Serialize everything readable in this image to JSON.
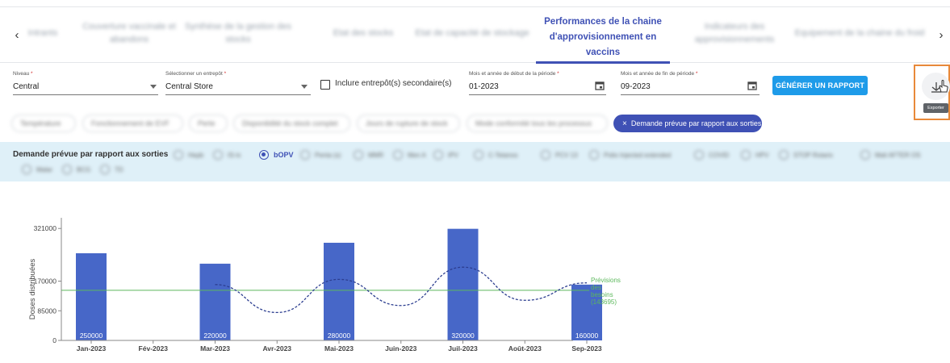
{
  "tabs": [
    {
      "label": "Intrants",
      "blurred": true
    },
    {
      "label": "Couverture vaccinale et abandons",
      "blurred": true
    },
    {
      "label": "Synthèse de la gestion des stocks",
      "blurred": true
    },
    {
      "label": "Etat des stocks",
      "blurred": true
    },
    {
      "label": "Etat de capacité de stockage",
      "blurred": true
    },
    {
      "label": "Performances de la chaine d'approvisionnement en vaccins",
      "blurred": false,
      "active": true
    },
    {
      "label": "Indicateurs des approvisionnements",
      "blurred": true
    },
    {
      "label": "Equipement de la chaine du froid",
      "blurred": true
    }
  ],
  "nav": {
    "prev": "‹",
    "next": "›"
  },
  "filters": {
    "niveau": {
      "label": "Niveau",
      "required": "*",
      "value": "Central"
    },
    "entrepot": {
      "label": "Sélectionner un entrepôt",
      "required": "*",
      "value": "Central Store"
    },
    "secondary": {
      "label": "Inclure entrepôt(s) secondaire(s)",
      "checked": false
    },
    "start": {
      "label": "Mois et année de début de la période",
      "required": "*",
      "value": "01-2023"
    },
    "end": {
      "label": "Mois et année de fin de période",
      "required": "*",
      "value": "09-2023"
    },
    "generate_label": "GÉNÉRER UN RAPPORT",
    "export_tooltip": "Exporter"
  },
  "chips": [
    {
      "label": "Température",
      "blurred": true
    },
    {
      "label": "Fonctionnement de EVF",
      "blurred": true
    },
    {
      "label": "Perte",
      "blurred": true
    },
    {
      "label": "Disponibilité du stock complet",
      "blurred": true
    },
    {
      "label": "Jours de rupture de stock",
      "blurred": true
    },
    {
      "label": "Mode conformité tous les processus",
      "blurred": true
    },
    {
      "label": "Demande prévue par rapport aux sorties",
      "blurred": false,
      "active": true,
      "close": "×"
    }
  ],
  "panel": {
    "title": "Demande prévue par rapport aux sorties",
    "options": [
      {
        "label": "Hepb",
        "selected": false
      },
      {
        "label": "IS-Ix",
        "selected": false
      },
      {
        "label": "bOPV",
        "selected": true
      },
      {
        "label": "Penta (s)",
        "selected": false
      },
      {
        "label": "MMR",
        "selected": false
      },
      {
        "label": "Men A",
        "selected": false
      },
      {
        "label": "IPV",
        "selected": false
      },
      {
        "label": "C-Tetanos",
        "selected": false
      },
      {
        "label": "PCV 13",
        "selected": false
      },
      {
        "label": "Polio Injected extended",
        "selected": false
      },
      {
        "label": "COVID",
        "selected": false
      },
      {
        "label": "HPV",
        "selected": false
      },
      {
        "label": "STOP Rotarix",
        "selected": false
      },
      {
        "label": "Mali AFTER OS",
        "selected": false
      },
      {
        "label": "Malar",
        "selected": false
      },
      {
        "label": "BCG",
        "selected": false
      },
      {
        "label": "TD",
        "selected": false
      }
    ]
  },
  "chart_data": {
    "type": "bar",
    "categories": [
      "Jan-2023",
      "Fév-2023",
      "Mar-2023",
      "Avr-2023",
      "Mai-2023",
      "Juin-2023",
      "Juil-2023",
      "Août-2023",
      "Sep-2023"
    ],
    "values": [
      250000,
      0,
      220000,
      0,
      280000,
      0,
      320000,
      0,
      160000
    ],
    "data_labels": [
      "250000",
      "",
      "220000",
      "",
      "280000",
      "",
      "320000",
      "",
      "160000"
    ],
    "trend": [
      null,
      null,
      160000,
      80000,
      175000,
      100000,
      210000,
      115000,
      165000
    ],
    "reference_line": {
      "value": 143695,
      "label_lines": [
        "Prévisions",
        "des",
        "besoins",
        "(143695)"
      ]
    },
    "ylabel": "Doses distribuées",
    "ytick_labels": [
      "0",
      "85000",
      "170000",
      "321000"
    ],
    "ylim": [
      0,
      340000
    ],
    "colors": {
      "bar": "#4767c8",
      "reference": "#5cb85c",
      "trend": "#2c3e90",
      "label": "#ffffff"
    }
  }
}
